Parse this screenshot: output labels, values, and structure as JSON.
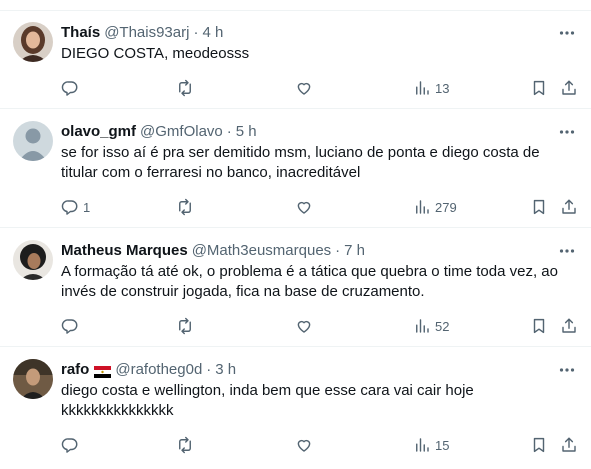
{
  "tweets": [
    {
      "name": "Thaís",
      "handle": "@Thais93arj",
      "sep": "·",
      "time": "4 h",
      "text": "DIEGO COSTA, meodeosss",
      "replies": "",
      "views": "13",
      "avatar_color": "#6b4a3a"
    },
    {
      "name": "olavo_gmf",
      "handle": "@GmfOlavo",
      "sep": "·",
      "time": "5 h",
      "text": "se for isso aí é pra ser demitido msm, luciano de ponta e diego costa de titular com o ferraresi no banco, inacreditável",
      "replies": "1",
      "views": "279",
      "avatar_color": "#cfd9de"
    },
    {
      "name": "Matheus Marques",
      "handle": "@Math3eusmarques",
      "sep": "·",
      "time": "7 h",
      "text": "A formação tá até ok, o problema é a tática que quebra o time toda vez, ao invés de construir jogada, fica na base de cruzamento.",
      "replies": "",
      "views": "52",
      "avatar_color": "#2b2b2b"
    },
    {
      "name": "rafo",
      "handle": "@rafotheg0d",
      "sep": "·",
      "time": "3 h",
      "text": "diego costa e wellington, inda bem que esse cara vai cair hoje kkkkkkkkkkkkkkk",
      "replies": "",
      "views": "15",
      "avatar_color": "#5a4636",
      "flag": "egypt-flag"
    }
  ],
  "colors": {
    "text": "#0f1419",
    "muted": "#536471",
    "border": "#eff3f4"
  }
}
